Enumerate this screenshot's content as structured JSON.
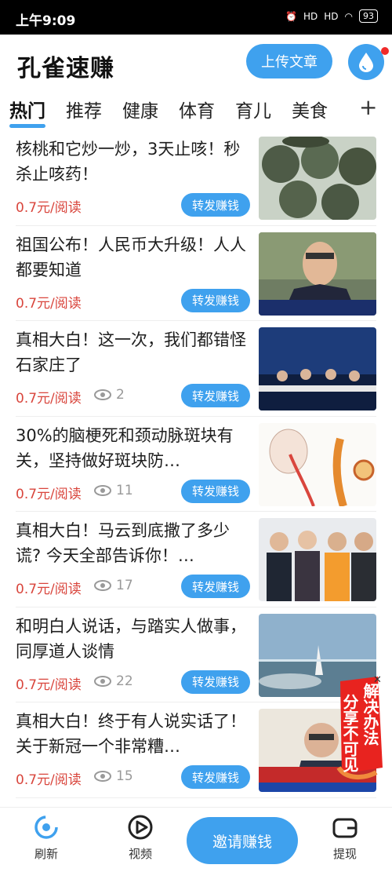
{
  "status_bar": {
    "time": "上午9:09",
    "battery": "93",
    "network_a": "HD",
    "network_b": "HD"
  },
  "header": {
    "app_title": "孔雀速赚",
    "upload_label": "上传文章"
  },
  "tabs": [
    "热门",
    "推荐",
    "健康",
    "体育",
    "育儿",
    "美食"
  ],
  "tab_add": "+",
  "share_label": "转发赚钱",
  "articles": [
    {
      "title": "核桃和它炒一炒，3天止咳！秒杀止咳药！",
      "price": "0.7元/阅读",
      "views": ""
    },
    {
      "title": "祖国公布！人民币大升级！人人都要知道",
      "price": "0.7元/阅读",
      "views": ""
    },
    {
      "title": "真相大白！这一次，我们都错怪石家庄了",
      "price": "0.7元/阅读",
      "views": "2"
    },
    {
      "title": "30%的脑梗死和颈动脉斑块有关，坚持做好斑块防…",
      "price": "0.7元/阅读",
      "views": "11"
    },
    {
      "title": "真相大白！马云到底撒了多少谎? 今天全部告诉你！…",
      "price": "0.7元/阅读",
      "views": "17"
    },
    {
      "title": "和明白人说话，与踏实人做事，同厚道人谈情",
      "price": "0.7元/阅读",
      "views": "22"
    },
    {
      "title": "真相大白！终于有人说实话了！关于新冠一个非常糟…",
      "price": "0.7元/阅读",
      "views": "15"
    }
  ],
  "float_banner": {
    "line1": "解决办法",
    "line2": "分享不可见"
  },
  "bottom_nav": {
    "refresh": "刷新",
    "video": "视频",
    "invite": "邀请赚钱",
    "withdraw": "提现"
  },
  "colors": {
    "accent": "#3fa1ee",
    "price": "#d9463d",
    "alert": "#f02a2a"
  }
}
